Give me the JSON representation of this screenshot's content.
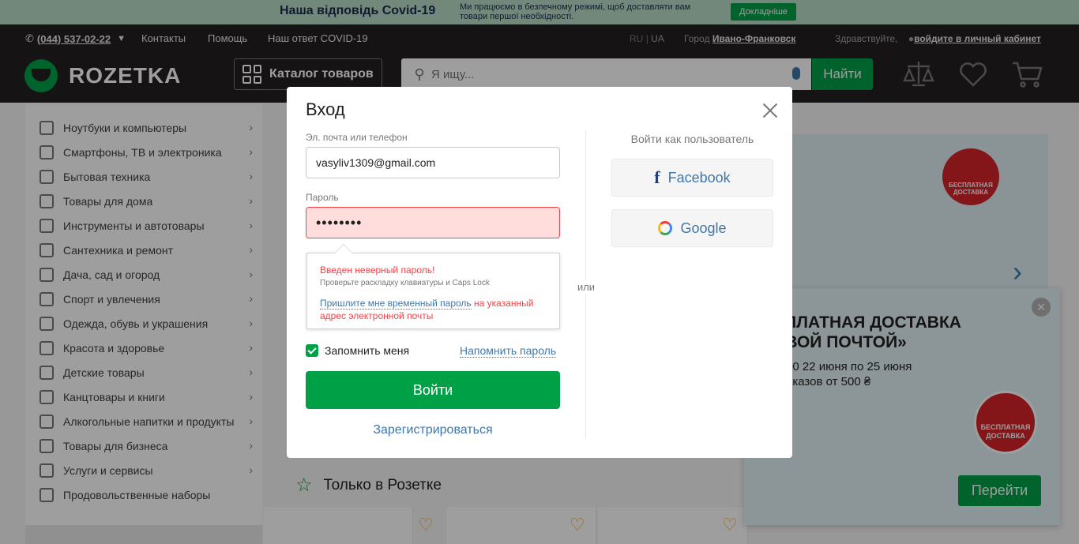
{
  "covid_banner": {
    "title": "Наша відповідь Covid-19",
    "text": "Ми працюємо в безпечному режимі, щоб доставляти вам товари першої необхідності.",
    "button": "Докладніше"
  },
  "header": {
    "phone": "(044) 537-02-22",
    "nav": [
      "Контакты",
      "Помощь",
      "Наш ответ COVID-19"
    ],
    "lang_ru": "RU",
    "lang_sep": "|",
    "lang_ua": "UA",
    "city_label": "Город",
    "city": "Ивано-Франковск",
    "greeting": "Здравствуйте,",
    "login_link": "войдите в личный кабинет",
    "logo_text": "ROZETKA",
    "catalog_label": "Каталог товаров",
    "search_placeholder": "Я ищу...",
    "search_button": "Найти"
  },
  "sidebar": {
    "items": [
      "Ноутбуки и компьютеры",
      "Смартфоны, ТВ и электроника",
      "Бытовая техника",
      "Товары для дома",
      "Инструменты и автотовары",
      "Сантехника и ремонт",
      "Дача, сад и огород",
      "Спорт и увлечения",
      "Одежда, обувь и украшения",
      "Красота и здоровье",
      "Детские товары",
      "Канцтовары и книги",
      "Алкогольные напитки и продукты",
      "Товары для бизнеса",
      "Услуги и сервисы",
      "Продовольственные наборы"
    ]
  },
  "main": {
    "banner_badge": "БЕСПЛАТНАЯ ДОСТАВКА",
    "section_title": "Только в Розетке"
  },
  "promo": {
    "title": "СПЛАТНАЯ ДОСТАВКА ОВОЙ ПОЧТОЙ»",
    "line1": "00 22 июня по 25 июня",
    "line2": "аказов от 500 ₴",
    "badge": "БЕСПЛАТНАЯ ДОСТАВКА",
    "button": "Перейти"
  },
  "modal": {
    "title": "Вход",
    "email_label": "Эл. почта или телефон",
    "email_value": "vasyliv1309@gmail.com",
    "password_label": "Пароль",
    "password_value": "••••••••",
    "error_title": "Введен неверный пароль!",
    "error_hint": "Проверьте раскладку клавиатуры и Caps Lock",
    "temp_password_link": "Пришлите мне временный пароль",
    "temp_password_rest": " на указанный адрес электронной почты",
    "remember_label": "Запомнить меня",
    "remind_link": "Напомнить пароль",
    "login_button": "Войти",
    "register_link": "Зарегистрироваться",
    "or_text": "или",
    "social_title": "Войти как пользователь",
    "facebook": "Facebook",
    "google": "Google"
  },
  "colors": {
    "brand_green": "#00a046",
    "header_dark": "#221f1f",
    "link_blue": "#3e77aa",
    "error_red": "#f84147"
  }
}
